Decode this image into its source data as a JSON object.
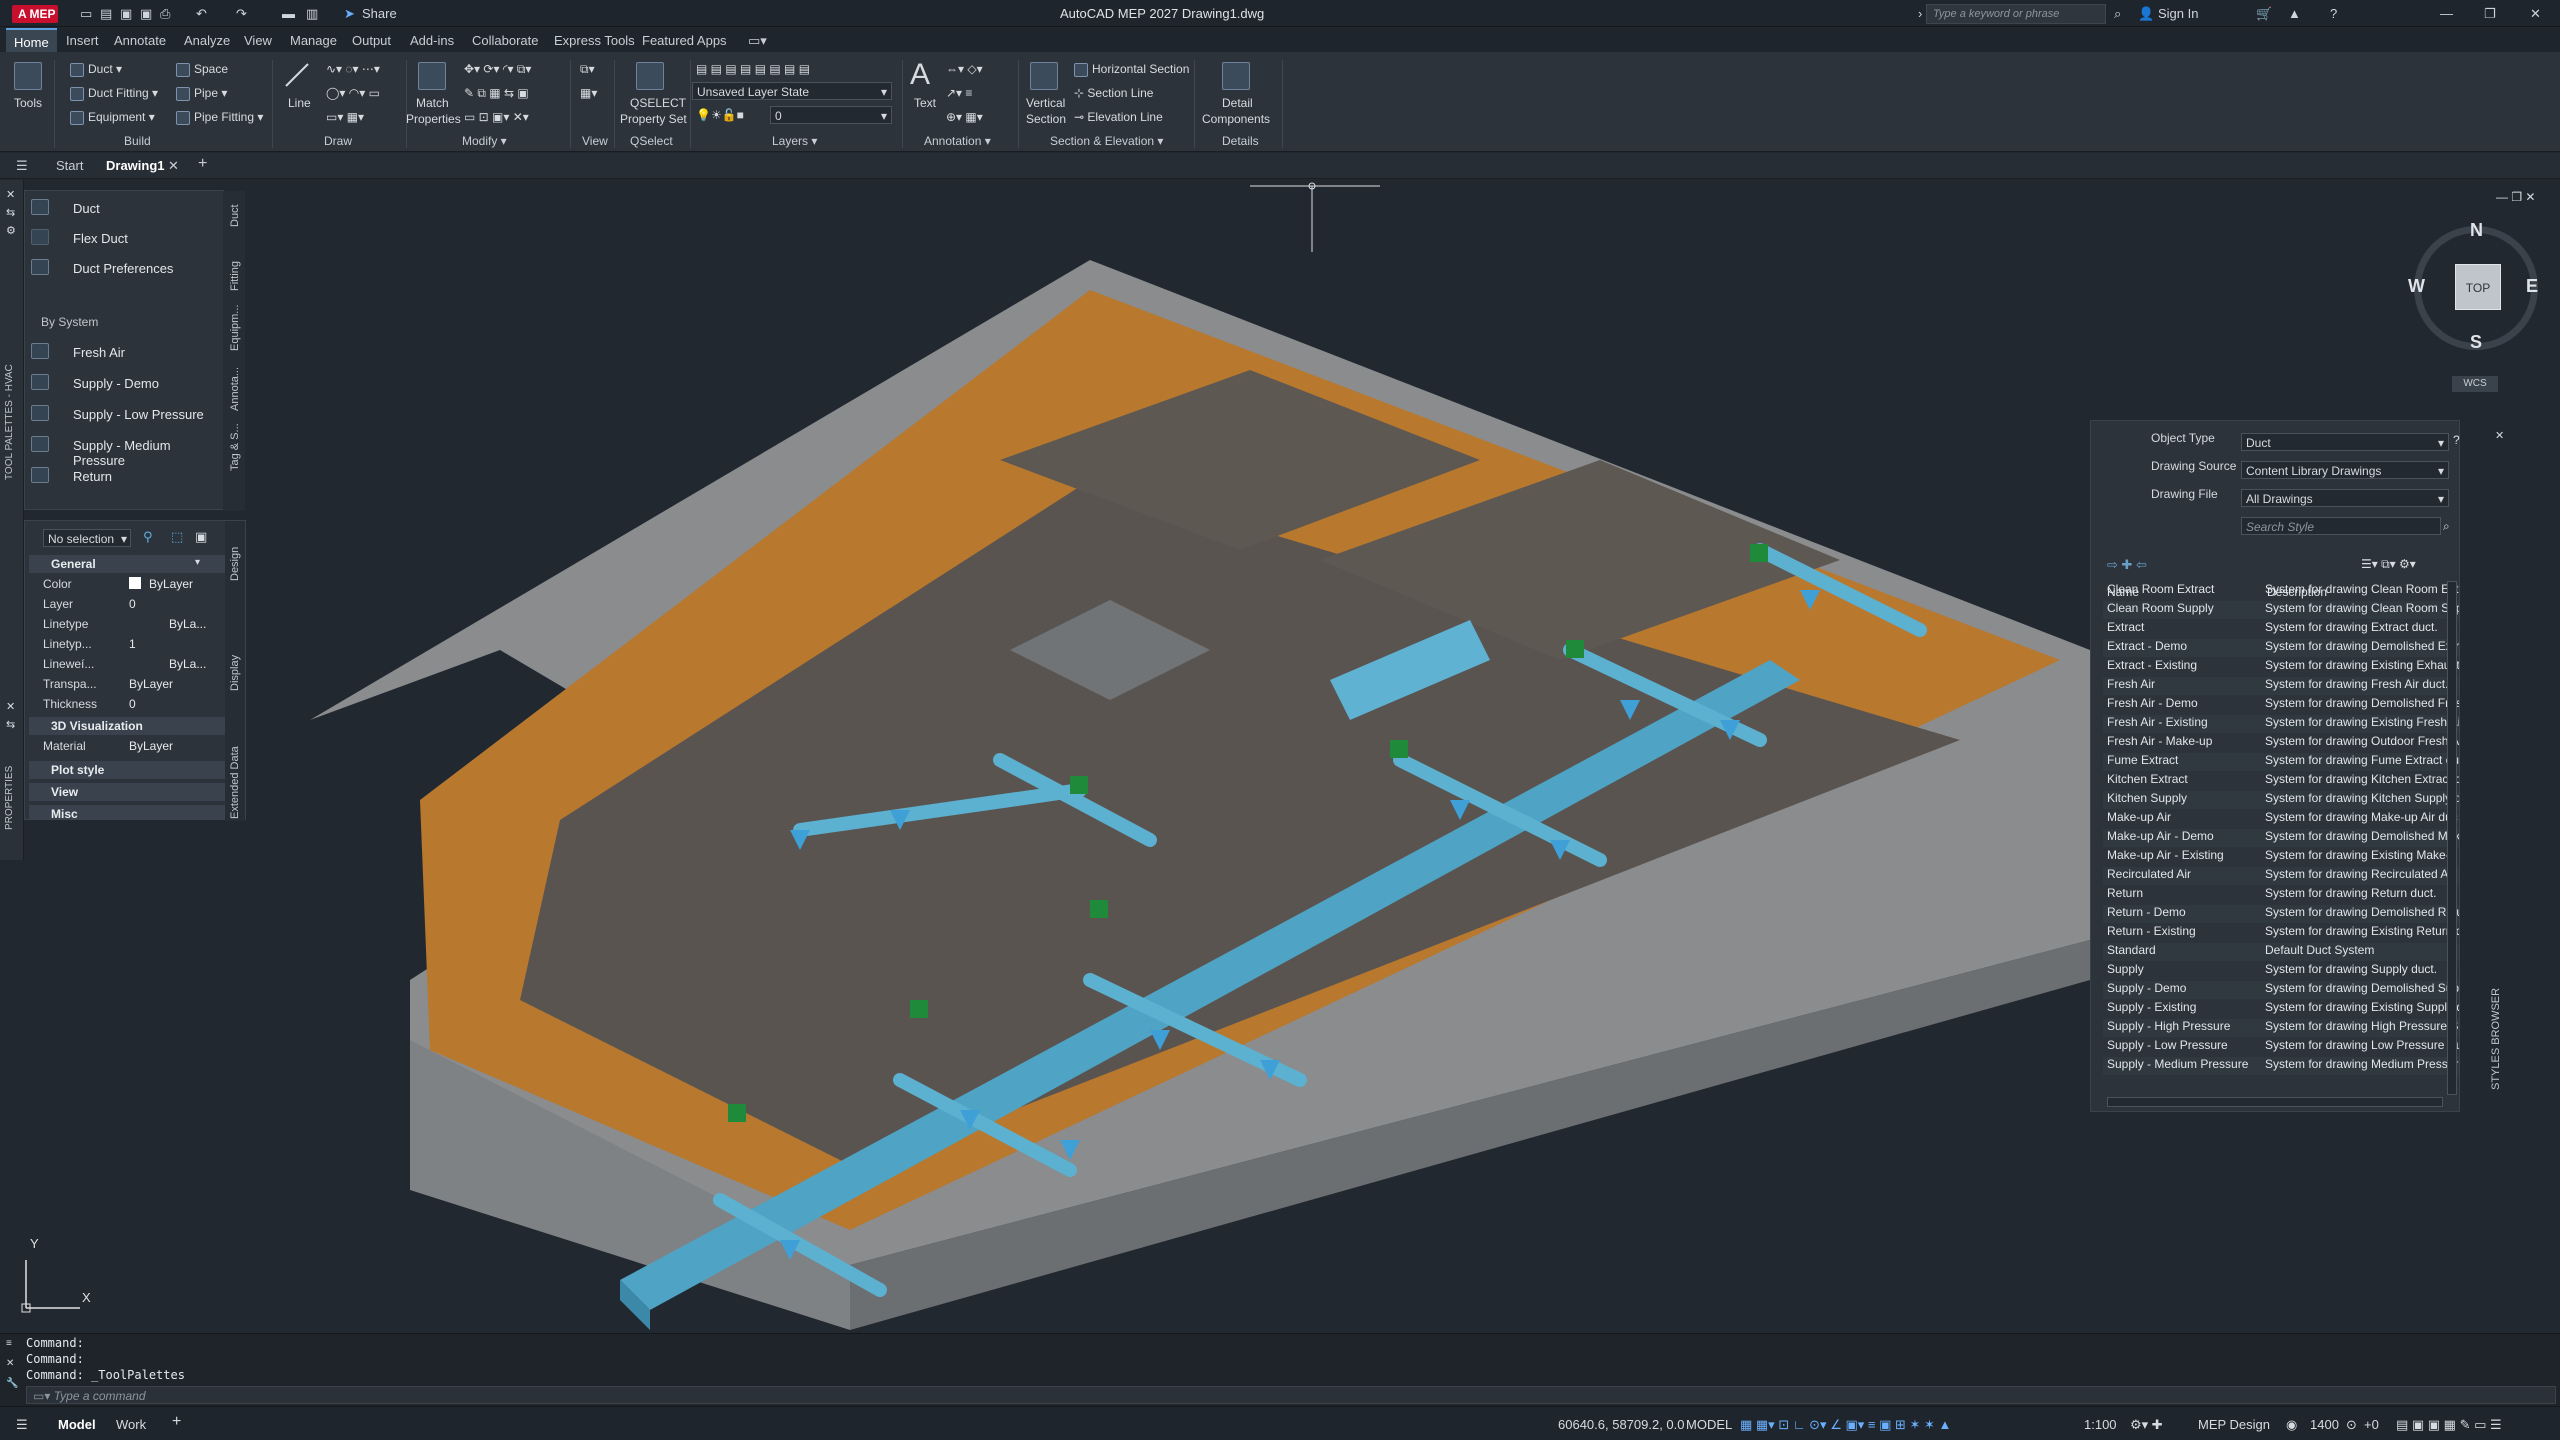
{
  "app": {
    "title": "AutoCAD MEP 2027    Drawing1.dwg",
    "logo": "A MEP",
    "share": "Share",
    "search_placeholder": "Type a keyword or phrase",
    "sign_in": "Sign In"
  },
  "menu": [
    "Home",
    "Insert",
    "Annotate",
    "Analyze",
    "View",
    "Manage",
    "Output",
    "Add-ins",
    "Collaborate",
    "Express Tools",
    "Featured Apps"
  ],
  "ribbon": {
    "tools": "Tools",
    "build": {
      "duct": "Duct",
      "space": "Space",
      "duct_fitting": "Duct Fitting",
      "pipe": "Pipe",
      "equipment": "Equipment",
      "pipe_fitting": "Pipe Fitting",
      "label": "Build"
    },
    "draw": {
      "line": "Line",
      "label": "Draw"
    },
    "modify": {
      "match": "Match",
      "properties": "Properties",
      "label": "Modify"
    },
    "view": {
      "label": "View"
    },
    "qselect": {
      "title": "QSELECT",
      "sub": "Property Set",
      "label": "QSelect"
    },
    "layers": {
      "state": "Unsaved Layer State",
      "layer": "0",
      "label": "Layers"
    },
    "annotation": {
      "text": "Text",
      "label": "Annotation"
    },
    "section": {
      "vertical": "Vertical",
      "section": "Section",
      "horizontal": "Horizontal Section",
      "section_line": "Section Line",
      "elevation_line": "Elevation Line",
      "label": "Section & Elevation"
    },
    "details": {
      "detail": "Detail",
      "components": "Components",
      "label": "Details"
    }
  },
  "tabs": {
    "start": "Start",
    "drawing": "Drawing1"
  },
  "toolpalette": {
    "items": [
      "Duct",
      "Flex Duct",
      "Duct Preferences"
    ],
    "by_system": "By System",
    "systems": [
      "Fresh Air",
      "Supply - Demo",
      "Supply - Low Pressure",
      "Supply - Medium Pressure",
      "Return"
    ],
    "vtabs": [
      "Duct",
      "Fitting",
      "Equipm...",
      "Annota...",
      "Tag & S..."
    ],
    "side_label": "TOOL PALETTES - HVAC"
  },
  "properties": {
    "selection": "No selection",
    "general": "General",
    "rows": [
      {
        "k": "Color",
        "v": "ByLayer"
      },
      {
        "k": "Layer",
        "v": "0"
      },
      {
        "k": "Linetype",
        "v": "ByLa..."
      },
      {
        "k": "Linetyp...",
        "v": "1"
      },
      {
        "k": "Lineweí...",
        "v": "ByLa..."
      },
      {
        "k": "Transpa...",
        "v": "ByLayer"
      },
      {
        "k": "Thickness",
        "v": "0"
      }
    ],
    "viz": "3D Visualization",
    "material_k": "Material",
    "material_v": "ByLayer",
    "sections": [
      "Plot style",
      "View",
      "Misc"
    ],
    "vtabs": [
      "Design",
      "Display",
      "Extended Data"
    ],
    "side_label": "PROPERTIES"
  },
  "viewcube": {
    "n": "N",
    "s": "S",
    "e": "E",
    "w": "W",
    "top": "TOP",
    "wcs": "WCS"
  },
  "styles": {
    "object_type_label": "Object Type",
    "object_type": "Duct",
    "source_label": "Drawing Source",
    "source": "Content Library Drawings",
    "file_label": "Drawing File",
    "file": "All Drawings",
    "search": "Search Style",
    "col_name": "Name",
    "col_desc": "Description",
    "side_label": "STYLES BROWSER",
    "rows": [
      [
        "Clean Room Extract",
        "System for drawing Clean Room Extr"
      ],
      [
        "Clean Room Supply",
        "System for drawing Clean Room Sup"
      ],
      [
        "Extract",
        "System for drawing Extract duct."
      ],
      [
        "Extract - Demo",
        "System for drawing Demolished Extr"
      ],
      [
        "Extract - Existing",
        "System for drawing Existing Exhaust"
      ],
      [
        "Fresh Air",
        "System for drawing Fresh Air duct."
      ],
      [
        "Fresh Air - Demo",
        "System for drawing Demolished Fres"
      ],
      [
        "Fresh Air - Existing",
        "System for drawing Existing Fresh Ai"
      ],
      [
        "Fresh Air - Make-up",
        "System for drawing Outdoor Fresh A"
      ],
      [
        "Fume Extract",
        "System for drawing Fume Extract du"
      ],
      [
        "Kitchen Extract",
        "System for drawing Kitchen Extract d"
      ],
      [
        "Kitchen Supply",
        "System for drawing Kitchen Supply d"
      ],
      [
        "Make-up Air",
        "System for drawing Make-up Air duc"
      ],
      [
        "Make-up Air - Demo",
        "System for drawing Demolished Mak"
      ],
      [
        "Make-up Air - Existing",
        "System for drawing Existing Make-u"
      ],
      [
        "Recirculated Air",
        "System for drawing Recirculated Air"
      ],
      [
        "Return",
        "System for drawing Return duct."
      ],
      [
        "Return - Demo",
        "System for drawing Demolished Retu"
      ],
      [
        "Return - Existing",
        "System for drawing Existing Return d"
      ],
      [
        "Standard",
        "Default Duct System"
      ],
      [
        "Supply",
        "System for drawing Supply duct."
      ],
      [
        "Supply - Demo",
        "System for drawing Demolished Sup"
      ],
      [
        "Supply - Existing",
        "System for drawing Existing Supply d"
      ],
      [
        "Supply - High Pressure",
        "System for drawing High Pressure S"
      ],
      [
        "Supply - Low Pressure",
        "System for drawing Low Pressure Su"
      ],
      [
        "Supply - Medium Pressure",
        "System for drawing Medium Pressur"
      ]
    ]
  },
  "command": {
    "lines": [
      "Command:",
      "Command:",
      "Command:  _ToolPalettes"
    ],
    "placeholder": "Type a command"
  },
  "axis": {
    "x": "X",
    "y": "Y"
  },
  "status": {
    "model_tab": "Model",
    "work_tab": "Work",
    "coords": "60640.6, 58709.2, 0.0",
    "model": "MODEL",
    "scale": "1:100",
    "workspace": "MEP Design",
    "elevation": "1400",
    "zero": "+0"
  },
  "colors": {
    "accent": "#5aa0e0",
    "duct": "#4fa3c4",
    "wall": "#b8782e",
    "floor": "#5a5450"
  }
}
